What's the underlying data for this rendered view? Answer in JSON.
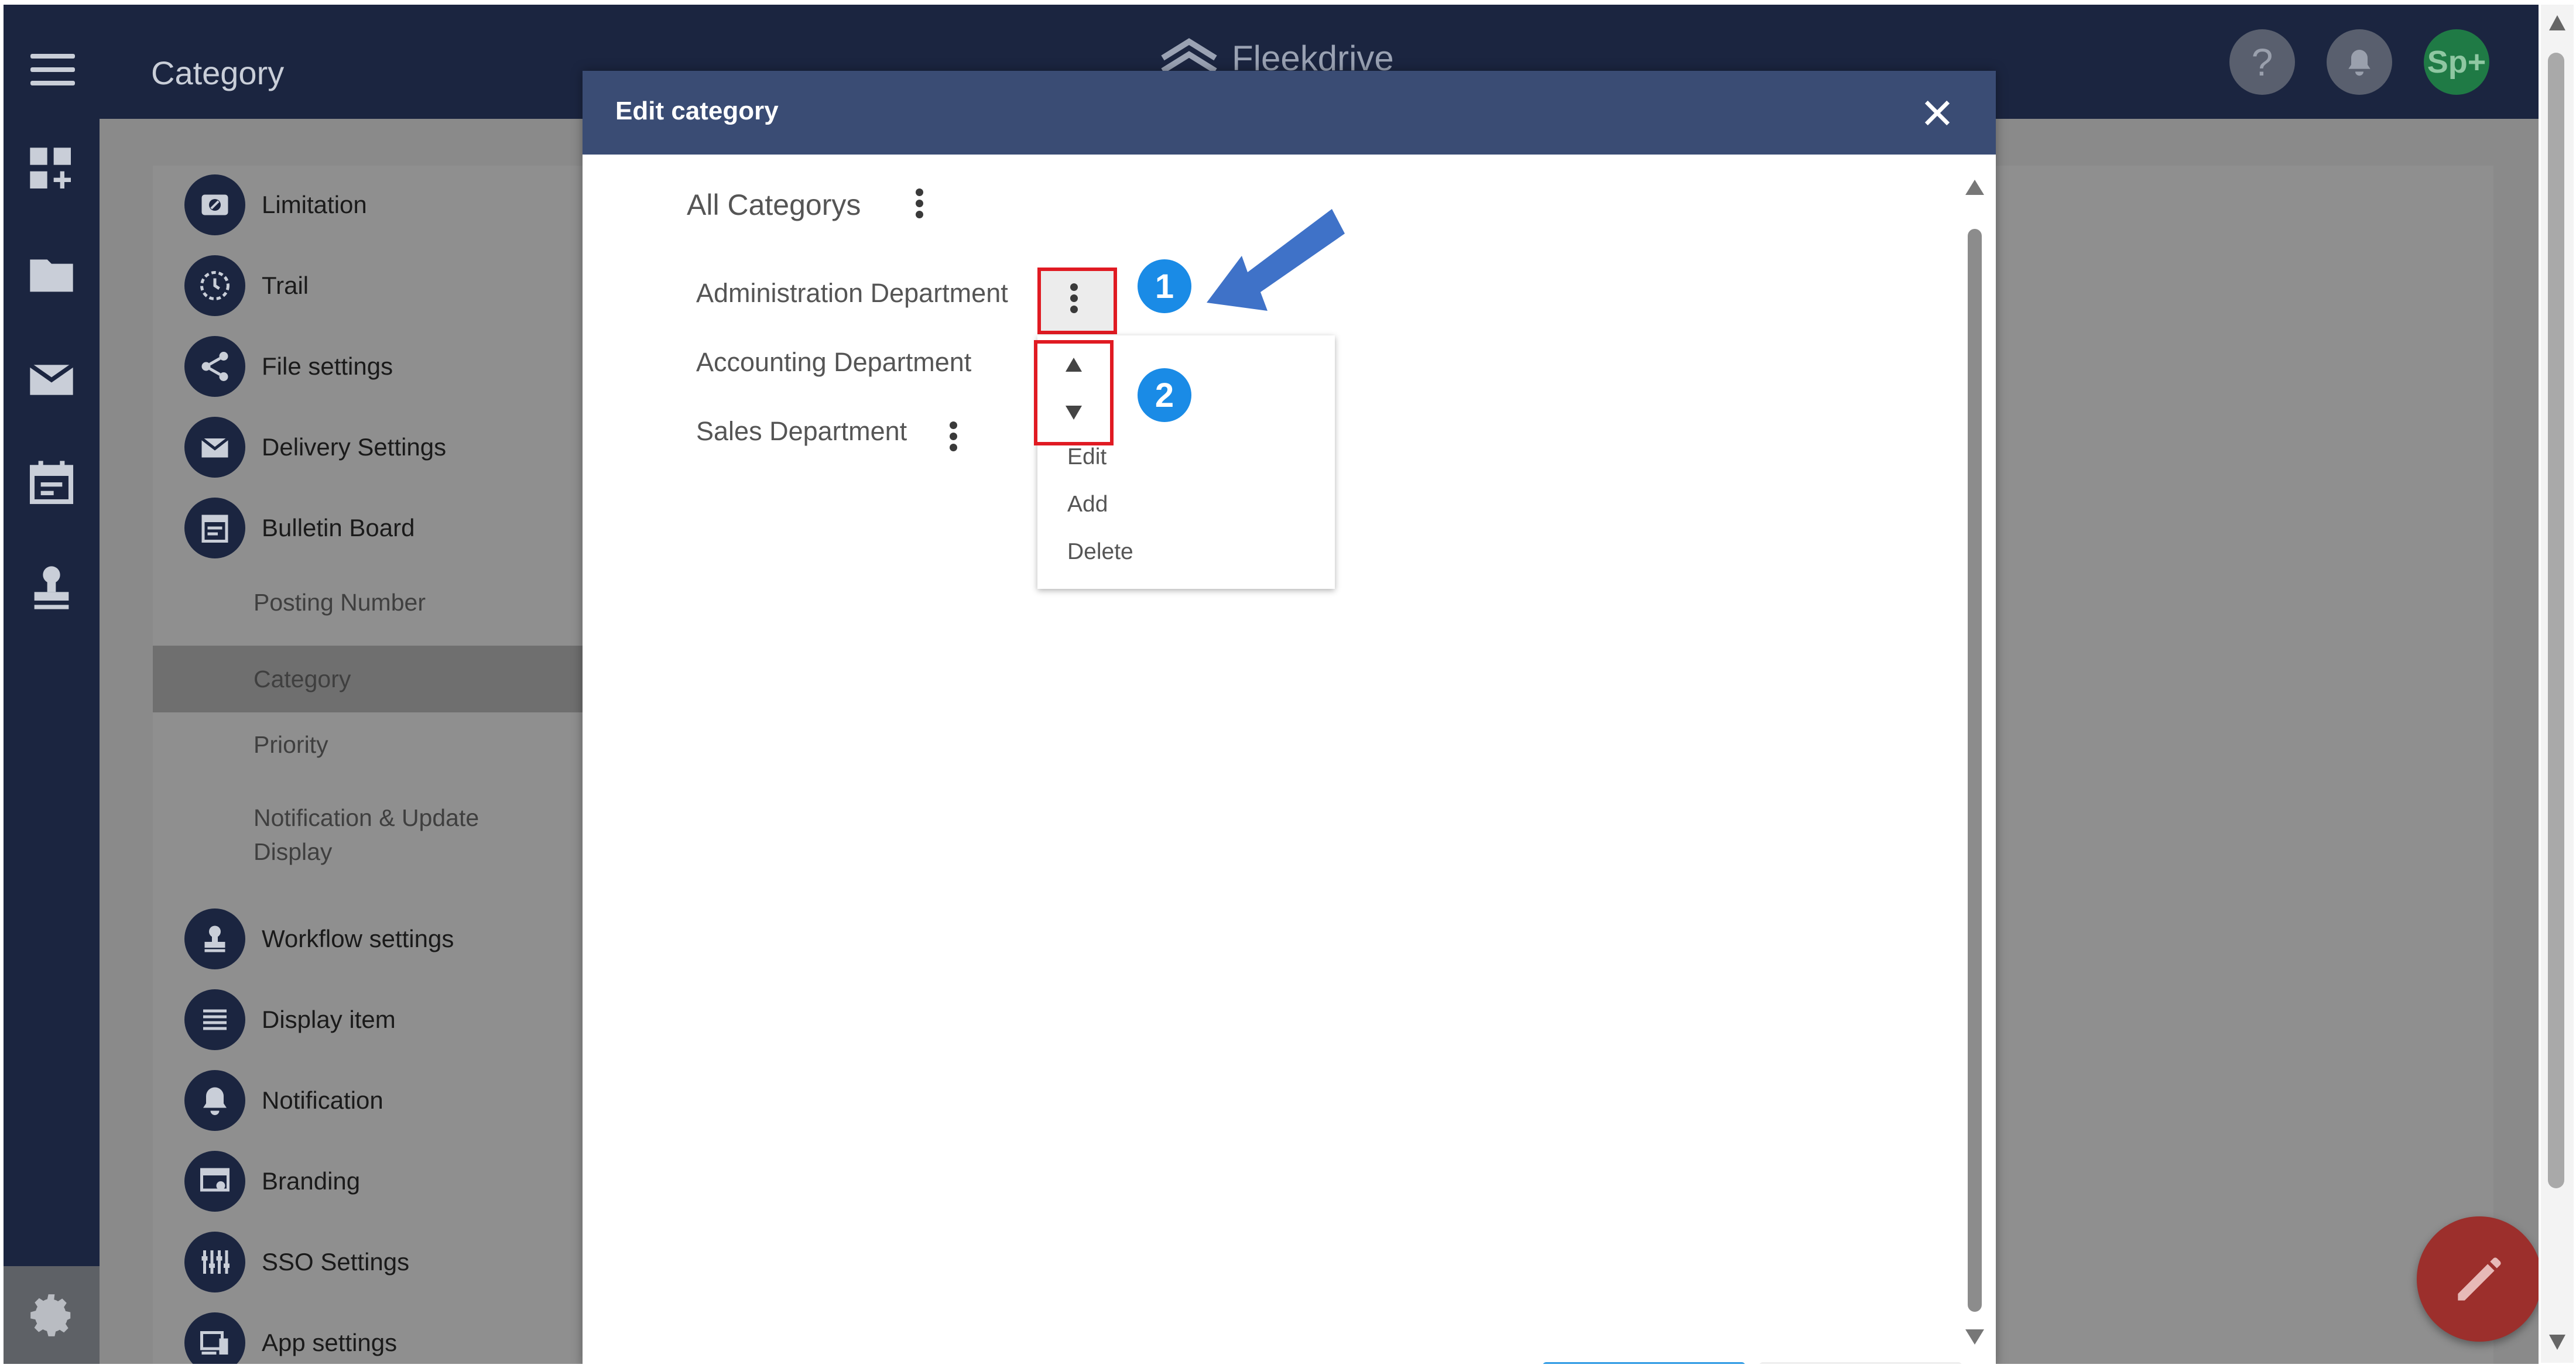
{
  "header": {
    "page_title": "Category",
    "brand_name": "Fleekdrive",
    "help_label": "?",
    "avatar_initials": "Sp+"
  },
  "settings_menu": {
    "items": [
      {
        "label": "Limitation",
        "icon": "limitation-icon"
      },
      {
        "label": "Trail",
        "icon": "clock-icon"
      },
      {
        "label": "File settings",
        "icon": "share-icon"
      },
      {
        "label": "Delivery Settings",
        "icon": "mail-icon"
      },
      {
        "label": "Bulletin Board",
        "icon": "bulletin-icon"
      }
    ],
    "sub_items": [
      "Posting Number",
      "Category",
      "Priority",
      "Notification & Update Display"
    ],
    "items_after": [
      {
        "label": "Workflow settings",
        "icon": "stamp-icon"
      },
      {
        "label": "Display item",
        "icon": "list-icon"
      },
      {
        "label": "Notification",
        "icon": "bell-icon"
      },
      {
        "label": "Branding",
        "icon": "branding-icon"
      },
      {
        "label": "SSO Settings",
        "icon": "sso-icon"
      },
      {
        "label": "App settings",
        "icon": "devices-icon"
      }
    ]
  },
  "modal": {
    "title": "Edit category",
    "root_label": "All Categorys",
    "categories": [
      "Administration Department",
      "Accounting Department",
      "Sales Department"
    ],
    "context_menu": [
      "Edit",
      "Add",
      "Delete"
    ],
    "callouts": [
      "1",
      "2"
    ]
  },
  "colors": {
    "header_bg": "#1b2540",
    "modal_header_bg": "#3a4c74",
    "highlight_red": "#e01a22",
    "callout_blue": "#1a8be6",
    "arrow_blue": "#3f72c8",
    "fab_red": "#9c2f2c"
  }
}
